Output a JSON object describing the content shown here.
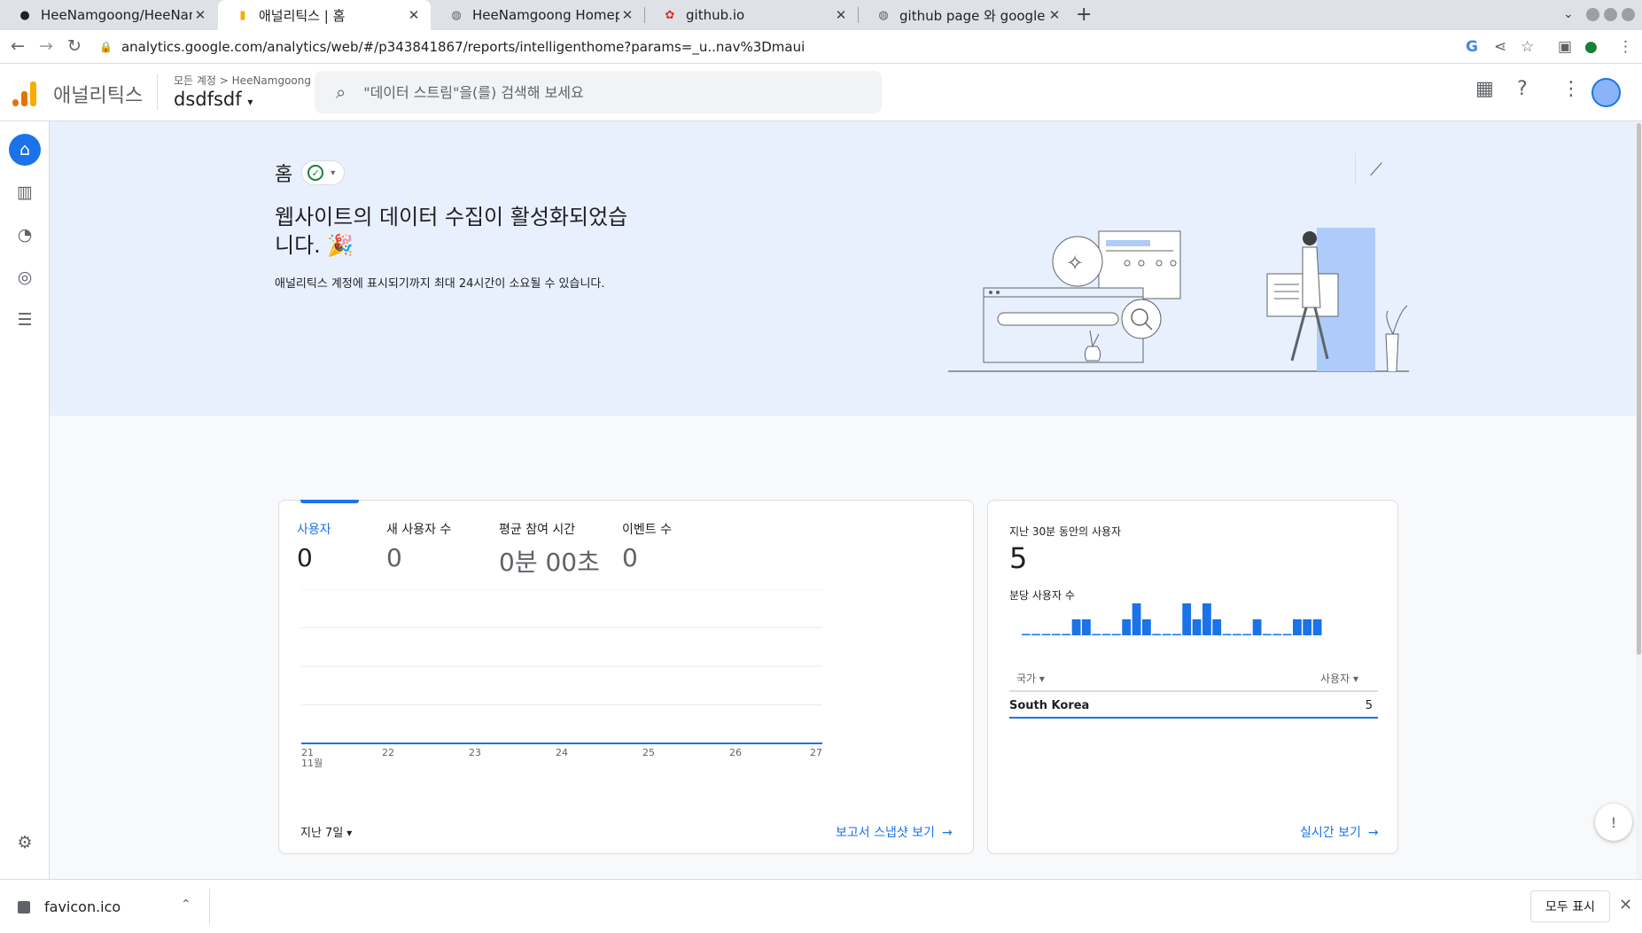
{
  "browser": {
    "tabs": [
      {
        "title": "HeeNamgoong/HeeNam",
        "favicon": "github-icon"
      },
      {
        "title": "애널리틱스 | 홈",
        "favicon": "analytics-icon",
        "active": true
      },
      {
        "title": "HeeNamgoong Homepag",
        "favicon": "globe-icon"
      },
      {
        "title": "github.io",
        "favicon": "flower-icon"
      },
      {
        "title": "github page 와 google an",
        "favicon": "globe-icon"
      }
    ],
    "url": "analytics.google.com/analytics/web/#/p343841867/reports/intelligenthome?params=_u..nav%3Dmaui"
  },
  "header": {
    "app_title": "애널리틱스",
    "breadcrumb": "모든 계정 > HeeNamgoong",
    "property": "dsdfsdf",
    "search_placeholder": "\"데이터 스트림\"을(를) 검색해 보세요"
  },
  "banner": {
    "page_title": "홈",
    "heading": "웹사이트의 데이터 수집이 활성화되었습니다. 🎉",
    "subtext": "애널리틱스 계정에 표시되기까지 최대 24시간이 소요될 수 있습니다."
  },
  "overview": {
    "metrics": [
      {
        "label": "사용자",
        "value": "0",
        "selected": true
      },
      {
        "label": "새 사용자 수",
        "value": "0"
      },
      {
        "label": "평균 참여 시간",
        "value": "0분 00초"
      },
      {
        "label": "이벤트 수",
        "value": "0"
      }
    ],
    "range": "지난 7일",
    "link": "보고서 스냅샷 보기"
  },
  "chart_data": {
    "type": "line",
    "x": [
      "21",
      "22",
      "23",
      "24",
      "25",
      "26",
      "27"
    ],
    "x_sublabel": "11월",
    "series": [
      {
        "values": [
          0,
          0,
          0,
          0,
          0,
          0,
          0
        ]
      }
    ],
    "color": "#1a73e8"
  },
  "realtime": {
    "label": "지난 30분 동안의 사용자",
    "value": "5",
    "sub_label": "분당 사용자 수",
    "per_minute": [
      0,
      0,
      0,
      0,
      0,
      1,
      1,
      0,
      0,
      0,
      1,
      2,
      1,
      0,
      0,
      0,
      2,
      1,
      2,
      1,
      0,
      0,
      0,
      1,
      0,
      0,
      0,
      1,
      1,
      1
    ],
    "col_country": "국가",
    "col_users": "사용자",
    "rows": [
      {
        "country": "South Korea",
        "users": "5"
      }
    ],
    "link": "실시간 보기"
  },
  "download": {
    "filename": "favicon.ico",
    "show_all": "모두 표시"
  },
  "colors": {
    "accent": "#1a73e8",
    "banner": "#e8f0fe",
    "logo_orange": "#f9ab00",
    "logo_dark": "#e37400"
  }
}
